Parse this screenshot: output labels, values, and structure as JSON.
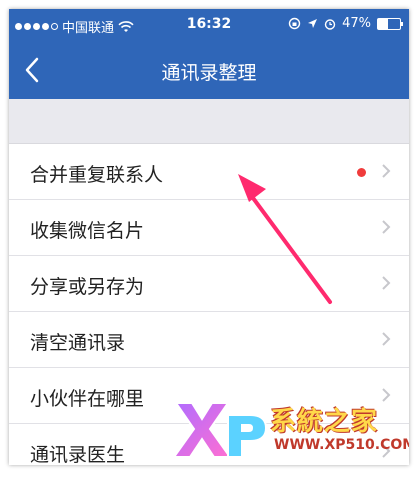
{
  "status_bar": {
    "carrier": "中国联通",
    "time": "16:32",
    "battery": "47%"
  },
  "nav": {
    "title": "通讯录整理",
    "back_icon": "chevron-left-icon"
  },
  "list": {
    "items": [
      {
        "label": "合并重复联系人",
        "badge": "red-dot"
      },
      {
        "label": "收集微信名片"
      },
      {
        "label": "分享或另存为"
      },
      {
        "label": "清空通讯录"
      },
      {
        "label": "小伙伴在哪里"
      },
      {
        "label": "通讯录医生"
      }
    ]
  },
  "watermark": {
    "logo_text": "XP",
    "title": "系統之家",
    "url": "WWW.XP510.COM"
  },
  "colors": {
    "nav_bg": "#2f66b8",
    "badge": "#f03c3c",
    "annotation_arrow": "#ff2a6e"
  }
}
